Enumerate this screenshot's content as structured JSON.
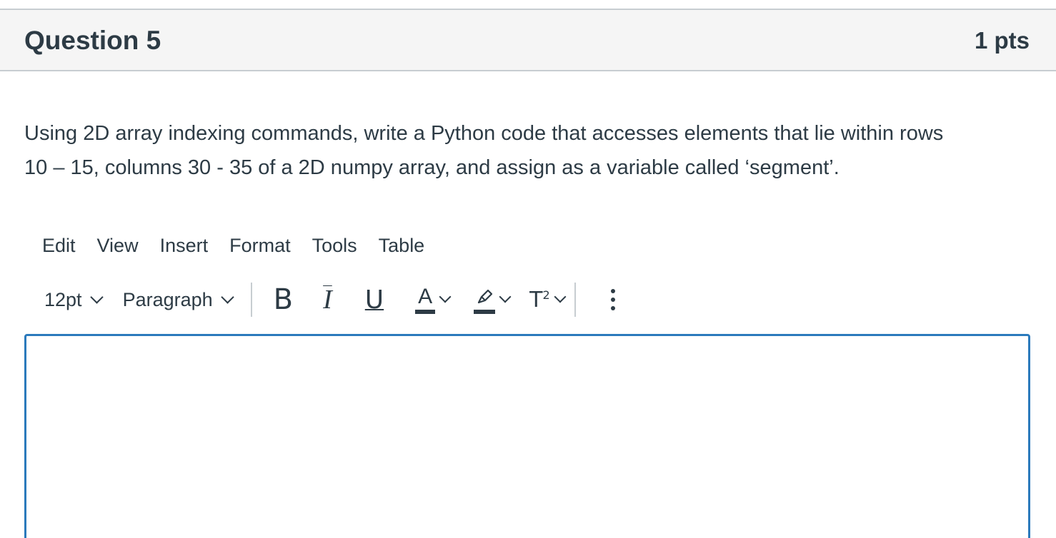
{
  "question": {
    "title": "Question 5",
    "points": "1 pts",
    "text_lines": [
      "Using 2D array indexing commands, write a Python code that accesses elements that lie within rows",
      "10 – 15, columns 30 - 35 of a 2D numpy array, and assign as a variable called ‘segment’."
    ]
  },
  "editor": {
    "menu": [
      "Edit",
      "View",
      "Insert",
      "Format",
      "Tools",
      "Table"
    ],
    "toolbar": {
      "font_size": "12pt",
      "block_format": "Paragraph",
      "bold_glyph": "B",
      "italic_glyph": "I",
      "underline_glyph": "U",
      "text_color_glyph": "A",
      "superscript_glyph": "T",
      "superscript_mark": "2"
    },
    "content": "",
    "border_color": "#2b7abc"
  },
  "icons": {
    "chevron": "chevron-down-icon",
    "highlight": "highlighter-icon",
    "more": "more-vertical-icon"
  }
}
